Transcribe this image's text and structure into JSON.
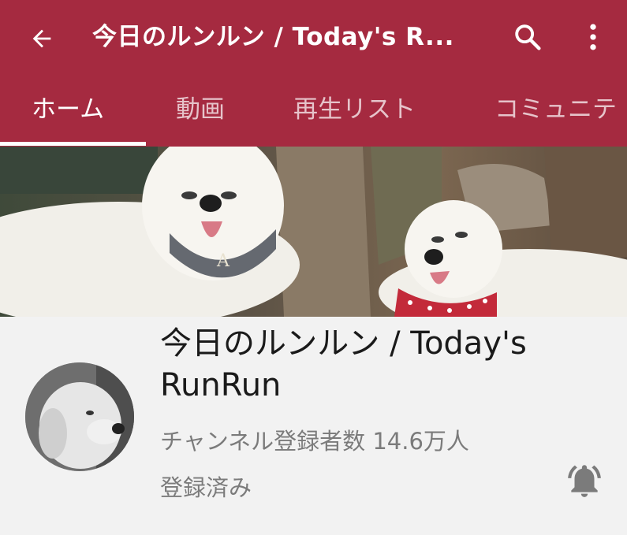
{
  "appbar": {
    "title": "今日のルンルン / Today's R...",
    "icons": [
      "back-arrow-icon",
      "search-icon",
      "more-vert-icon"
    ]
  },
  "tabs": [
    {
      "label": "ホーム",
      "active": true
    },
    {
      "label": "動画",
      "active": false
    },
    {
      "label": "再生リスト",
      "active": false
    },
    {
      "label": "コミュニテ",
      "active": false
    }
  ],
  "channel": {
    "name": "今日のルンルン / Today's RunRun",
    "subscribers": "チャンネル登録者数 14.6万人",
    "subscribed_label": "登録済み"
  },
  "banner": {
    "bib_letter": "A"
  },
  "colors": {
    "brand": "#a52a40",
    "background": "#f2f2f2",
    "secondary_text": "#7b7b7b"
  }
}
